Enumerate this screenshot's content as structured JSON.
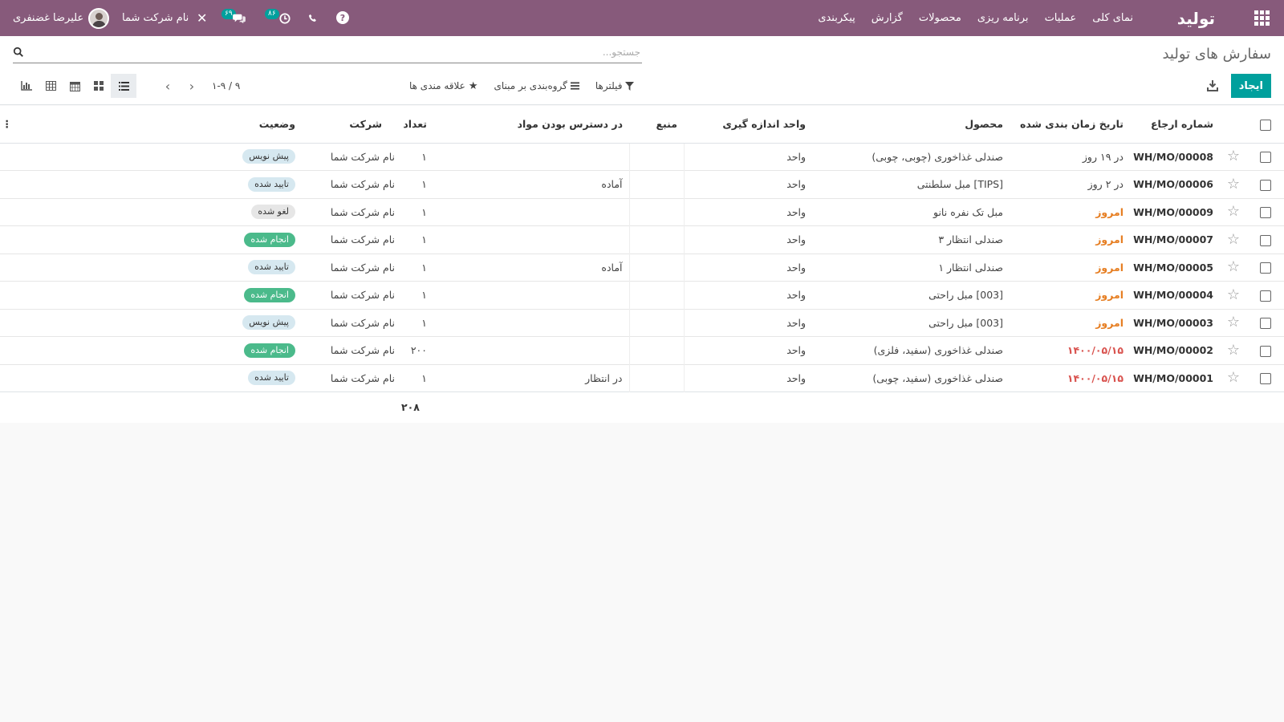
{
  "navbar": {
    "app_title": "تولید",
    "menu": [
      "نمای کلی",
      "عملیات",
      "برنامه ریزی",
      "محصولات",
      "گزارش",
      "پیکربندی"
    ],
    "company": "نام شرکت شما",
    "user": "علیرضا غضنفری",
    "chat_count": "۶۹",
    "activity_count": "۸۶",
    "color": "#875a7b"
  },
  "control": {
    "breadcrumb": "سفارش های تولید",
    "search_placeholder": "جستجو...",
    "create_label": "ایجاد",
    "filters_label": "فیلترها",
    "groupby_label": "گروه‌بندی بر مبنای",
    "favorites_label": "علاقه مندی ها",
    "pager_value": "۱-۹ / ۹",
    "accent": "#00a09d"
  },
  "table": {
    "headers": {
      "reference": "شماره ارجاع",
      "date": "تاریخ زمان بندی شده",
      "product": "محصول",
      "uom": "واحد اندازه گیری",
      "source": "منبع",
      "availability": "در دسترس بودن مواد",
      "qty": "تعداد",
      "company": "شرکت",
      "state": "وضعیت"
    },
    "rows": [
      {
        "ref": "WH/MO/00008",
        "date": "در ۱۹ روز",
        "product": "صندلی غذاخوری (چوبی، چوبی)",
        "uom": "واحد",
        "source": "",
        "availability": "",
        "qty": "۱",
        "company": "نام شرکت شما",
        "state": "پیش نویس"
      },
      {
        "ref": "WH/MO/00006",
        "date": "در ۲ روز",
        "product": "[TIPS] مبل سلطنتی",
        "uom": "واحد",
        "source": "",
        "availability": "آماده",
        "qty": "۱",
        "company": "نام شرکت شما",
        "state": "تایید شده"
      },
      {
        "ref": "WH/MO/00009",
        "date": "امروز",
        "product": "مبل تک نفره نانو",
        "uom": "واحد",
        "source": "",
        "availability": "",
        "qty": "۱",
        "company": "نام شرکت شما",
        "state": "لغو شده"
      },
      {
        "ref": "WH/MO/00007",
        "date": "امروز",
        "product": "صندلی انتظار ۳",
        "uom": "واحد",
        "source": "",
        "availability": "",
        "qty": "۱",
        "company": "نام شرکت شما",
        "state": "انجام شده"
      },
      {
        "ref": "WH/MO/00005",
        "date": "امروز",
        "product": "صندلی انتظار ۱",
        "uom": "واحد",
        "source": "",
        "availability": "آماده",
        "qty": "۱",
        "company": "نام شرکت شما",
        "state": "تایید شده"
      },
      {
        "ref": "WH/MO/00004",
        "date": "امروز",
        "product": "[003] مبل راحتی",
        "uom": "واحد",
        "source": "",
        "availability": "",
        "qty": "۱",
        "company": "نام شرکت شما",
        "state": "انجام شده"
      },
      {
        "ref": "WH/MO/00003",
        "date": "امروز",
        "product": "[003] مبل راحتی",
        "uom": "واحد",
        "source": "",
        "availability": "",
        "qty": "۱",
        "company": "نام شرکت شما",
        "state": "پیش نویس"
      },
      {
        "ref": "WH/MO/00002",
        "date": "۱۴۰۰/۰۵/۱۵",
        "product": "صندلی غذاخوری (سفید، فلزی)",
        "uom": "واحد",
        "source": "",
        "availability": "",
        "qty": "۲۰۰",
        "company": "نام شرکت شما",
        "state": "انجام شده"
      },
      {
        "ref": "WH/MO/00001",
        "date": "۱۴۰۰/۰۵/۱۵",
        "product": "صندلی غذاخوری (سفید، چوبی)",
        "uom": "واحد",
        "source": "",
        "availability": "در انتظار",
        "qty": "۱",
        "company": "نام شرکت شما",
        "state": "تایید شده"
      }
    ],
    "total_qty": "۲۰۸"
  }
}
